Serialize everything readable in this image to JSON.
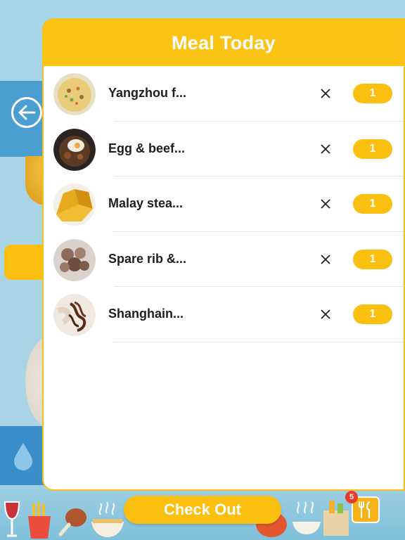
{
  "header": {
    "title": "Meal Today"
  },
  "meals": [
    {
      "name": "Yangzhou f...",
      "quantity": "1",
      "thumb_icon": "fried-rice-photo",
      "remove_icon": "close-icon"
    },
    {
      "name": "Egg & beef...",
      "quantity": "1",
      "thumb_icon": "egg-beef-rice-photo",
      "remove_icon": "close-icon"
    },
    {
      "name": "Malay stea...",
      "quantity": "1",
      "thumb_icon": "steamed-cake-photo",
      "remove_icon": "close-icon"
    },
    {
      "name": "Spare rib &...",
      "quantity": "1",
      "thumb_icon": "spare-rib-photo",
      "remove_icon": "close-icon"
    },
    {
      "name": "Shanghain...",
      "quantity": "1",
      "thumb_icon": "noodles-photo",
      "remove_icon": "close-icon"
    }
  ],
  "footer": {
    "checkout_label": "Check Out",
    "cart_count": "5",
    "cart_icon": "fork-knife-icon"
  },
  "nav": {
    "back_icon": "back-arrow-icon"
  },
  "colors": {
    "accent": "#fbbf0f",
    "header": "#fbc313",
    "background": "#a9d4e6"
  }
}
